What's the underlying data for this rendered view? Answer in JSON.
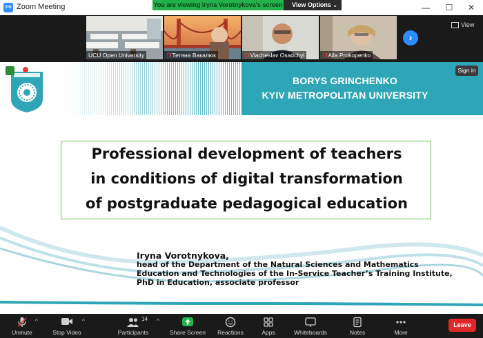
{
  "window": {
    "title": "Zoom Meeting",
    "app_icon_label": "zm",
    "minimize": "—",
    "maximize": "☐",
    "close": "✕"
  },
  "share": {
    "banner": "You are viewing Iryna Vorotnykova's screen",
    "view_options": "View Options"
  },
  "gallery": {
    "participants": [
      {
        "name": "UCU Open University",
        "muted": false
      },
      {
        "name": "Тетяна Вакалюк",
        "muted": true
      },
      {
        "name": "Viacheslav Osadchyi",
        "muted": true
      },
      {
        "name": "Alla Prokopenko",
        "muted": true
      }
    ],
    "view_label": "View"
  },
  "slide": {
    "university_line1": "BORYS GRINCHENKO",
    "university_line2": "KYIV METROPOLITAN UNIVERSITY",
    "sign_in": "Sign in",
    "title_lines": [
      "Professional development of teachers",
      "in conditions of digital transformation",
      "of postgraduate pedagogical education"
    ],
    "author_name": "Iryna Vorotnykova,",
    "author_lines": [
      "head of the Department of the Natural Sciences and Mathematics",
      "Education and Technologies of the In-Service Teacher’s Training Institute,",
      "PhD in Education, associate professor"
    ],
    "accent_color": "#2fa6b7"
  },
  "toolbar": {
    "unmute": "Unmute",
    "stop_video": "Stop Video",
    "participants": "Participants",
    "participants_count": "14",
    "share_screen": "Share Screen",
    "reactions": "Reactions",
    "apps": "Apps",
    "whiteboards": "Whiteboards",
    "notes": "Notes",
    "more": "More",
    "leave": "Leave"
  }
}
